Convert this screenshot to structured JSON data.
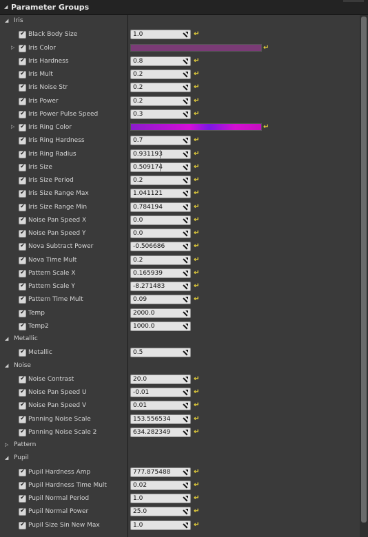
{
  "panel": {
    "title": "Parameter Groups"
  },
  "groups": [
    {
      "name": "Iris",
      "expanded": true,
      "params": [
        {
          "label": "Black Body Size",
          "value": "1.0"
        },
        {
          "label": "Iris Color",
          "type": "color",
          "color": "#7a3b76"
        },
        {
          "label": "Iris Hardness",
          "value": "0.8"
        },
        {
          "label": "Iris Mult",
          "value": "0.2"
        },
        {
          "label": "Iris Noise Str",
          "value": "0.2"
        },
        {
          "label": "Iris Power",
          "value": "0.2"
        },
        {
          "label": "Iris Power Pulse Speed",
          "value": "0.3"
        },
        {
          "label": "Iris Ring Color",
          "type": "color",
          "color": "#b313d3"
        },
        {
          "label": "Iris Ring Hardness",
          "value": "0.7"
        },
        {
          "label": "Iris Ring Radius",
          "value": "0.931193"
        },
        {
          "label": "Iris Size",
          "value": "0.509174"
        },
        {
          "label": "Iris Size Period",
          "value": "0.2"
        },
        {
          "label": "Iris Size Range Max",
          "value": "1.041121"
        },
        {
          "label": "Iris Size Range Min",
          "value": "0.784194"
        },
        {
          "label": "Noise Pan Speed X",
          "value": "0.0"
        },
        {
          "label": "Noise Pan Speed Y",
          "value": "0.0"
        },
        {
          "label": "Nova Subtract Power",
          "value": "-0.506686"
        },
        {
          "label": "Nova Time Mult",
          "value": "0.2"
        },
        {
          "label": "Pattern Scale X",
          "value": "0.165939"
        },
        {
          "label": "Pattern Scale Y",
          "value": "-8.271483"
        },
        {
          "label": "Pattern Time Mult",
          "value": "0.09"
        },
        {
          "label": "Temp",
          "value": "2000.0"
        },
        {
          "label": "Temp2",
          "value": "1000.0"
        }
      ]
    },
    {
      "name": "Metallic",
      "expanded": true,
      "params": [
        {
          "label": "Metallic",
          "value": "0.5"
        }
      ]
    },
    {
      "name": "Noise",
      "expanded": true,
      "params": [
        {
          "label": "Noise Contrast",
          "value": "20.0"
        },
        {
          "label": "Noise Pan Speed U",
          "value": "-0.01"
        },
        {
          "label": "Noise Pan Speed V",
          "value": "0.01"
        },
        {
          "label": "Panning Noise Scale",
          "value": "153.556534"
        },
        {
          "label": "Panning Noise Scale 2",
          "value": "634.282349"
        }
      ]
    },
    {
      "name": "Pattern",
      "expanded": false,
      "params": []
    },
    {
      "name": "Pupil",
      "expanded": true,
      "params": [
        {
          "label": "Pupil Hardness Amp",
          "value": "777.875488"
        },
        {
          "label": "Pupil Hardness Time Mult",
          "value": "0.02"
        },
        {
          "label": "Pupil Normal Period",
          "value": "1.0"
        },
        {
          "label": "Pupil Normal Power",
          "value": "25.0"
        },
        {
          "label": "Pupil Size Sin New Max",
          "value": "1.0"
        }
      ]
    }
  ],
  "no_reset_labels": [
    "Temp",
    "Temp2",
    "Metallic"
  ],
  "focused_labels": [
    "Iris Ring Radius",
    "Iris Size"
  ],
  "icons": {
    "collapse": "triangle-down-icon",
    "expand": "triangle-right-icon",
    "reset": "reset-arrow-icon"
  },
  "colors": {
    "reset_arrow": "#e8d23a",
    "panel_bg": "#3a3a3a",
    "header_bg": "#232323"
  }
}
